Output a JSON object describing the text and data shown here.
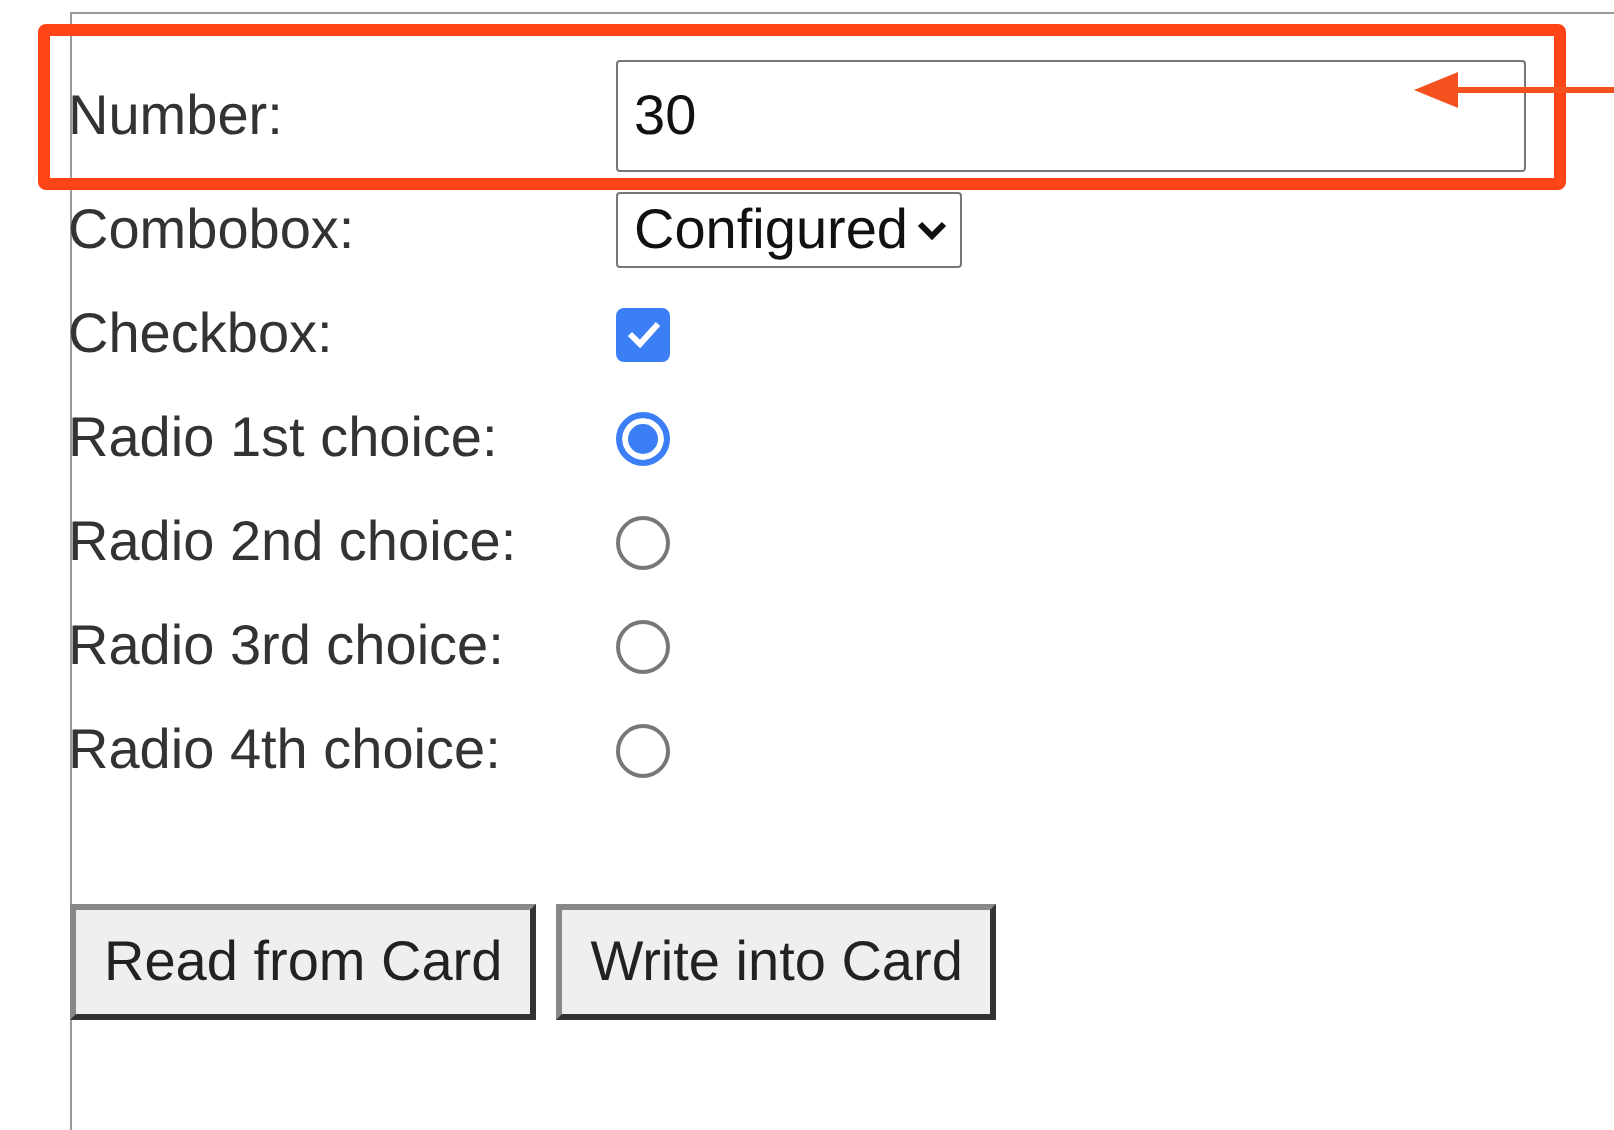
{
  "fields": [
    {
      "kind": "number",
      "label": "Number:",
      "value": "30",
      "highlighted": true
    },
    {
      "kind": "select",
      "label": "Combobox:",
      "value": "Configured",
      "highlighted": false
    },
    {
      "kind": "checkbox",
      "label": "Checkbox:",
      "checked": true,
      "highlighted": false
    },
    {
      "kind": "radio",
      "label": "Radio 1st choice:",
      "selected": true,
      "highlighted": false
    },
    {
      "kind": "radio",
      "label": "Radio 2nd choice:",
      "selected": false,
      "highlighted": false
    },
    {
      "kind": "radio",
      "label": "Radio 3rd choice:",
      "selected": false,
      "highlighted": false
    },
    {
      "kind": "radio",
      "label": "Radio 4th choice:",
      "selected": false,
      "highlighted": false
    }
  ],
  "buttons": [
    "Read from Card",
    "Write into Card"
  ]
}
